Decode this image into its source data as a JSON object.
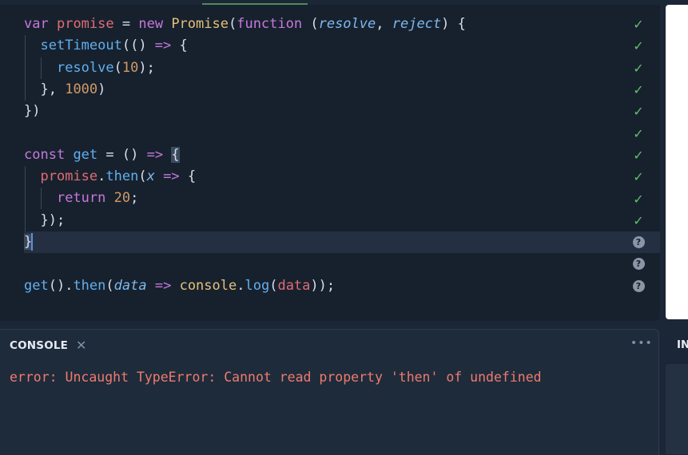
{
  "editor": {
    "lines": [
      [
        [
          "kw",
          "var"
        ],
        [
          "plain",
          " "
        ],
        [
          "var",
          "promise"
        ],
        [
          "plain",
          " = "
        ],
        [
          "kw",
          "new"
        ],
        [
          "plain",
          " "
        ],
        [
          "cls",
          "Promise"
        ],
        [
          "punc",
          "("
        ],
        [
          "kw",
          "function"
        ],
        [
          "plain",
          " ("
        ],
        [
          "par",
          "resolve"
        ],
        [
          "punc",
          ", "
        ],
        [
          "par",
          "reject"
        ],
        [
          "punc",
          ") {"
        ]
      ],
      [
        [
          "plain",
          "  "
        ],
        [
          "fn",
          "setTimeout"
        ],
        [
          "punc",
          "(() "
        ],
        [
          "op",
          "=>"
        ],
        [
          "punc",
          " {"
        ]
      ],
      [
        [
          "plain",
          "    "
        ],
        [
          "fn",
          "resolve"
        ],
        [
          "punc",
          "("
        ],
        [
          "num",
          "10"
        ],
        [
          "punc",
          ");"
        ]
      ],
      [
        [
          "plain",
          "  "
        ],
        [
          "punc",
          "}, "
        ],
        [
          "num",
          "1000"
        ],
        [
          "punc",
          ")"
        ]
      ],
      [
        [
          "punc",
          "})"
        ]
      ],
      [],
      [
        [
          "kw",
          "const"
        ],
        [
          "plain",
          " "
        ],
        [
          "fn",
          "get"
        ],
        [
          "plain",
          " = () "
        ],
        [
          "op",
          "=>"
        ],
        [
          "plain",
          " "
        ],
        [
          "hl",
          "{"
        ]
      ],
      [
        [
          "plain",
          "  "
        ],
        [
          "var",
          "promise"
        ],
        [
          "punc",
          "."
        ],
        [
          "fn",
          "then"
        ],
        [
          "punc",
          "("
        ],
        [
          "par",
          "x"
        ],
        [
          "plain",
          " "
        ],
        [
          "op",
          "=>"
        ],
        [
          "punc",
          " {"
        ]
      ],
      [
        [
          "plain",
          "    "
        ],
        [
          "kw",
          "return"
        ],
        [
          "plain",
          " "
        ],
        [
          "num",
          "20"
        ],
        [
          "punc",
          ";"
        ]
      ],
      [
        [
          "plain",
          "  "
        ],
        [
          "punc",
          "});"
        ]
      ],
      [
        [
          "hl",
          "}"
        ],
        [
          "cursor",
          ""
        ]
      ],
      [],
      [
        [
          "fn",
          "get"
        ],
        [
          "punc",
          "()."
        ],
        [
          "fn",
          "then"
        ],
        [
          "punc",
          "("
        ],
        [
          "par",
          "data"
        ],
        [
          "plain",
          " "
        ],
        [
          "op",
          "=>"
        ],
        [
          "plain",
          " "
        ],
        [
          "cls",
          "console"
        ],
        [
          "punc",
          "."
        ],
        [
          "fn",
          "log"
        ],
        [
          "punc",
          "("
        ],
        [
          "var",
          "data"
        ],
        [
          "punc",
          "));"
        ]
      ]
    ],
    "gutter_marks": [
      "check",
      "check",
      "check",
      "check",
      "check",
      "check",
      "check",
      "check",
      "check",
      "check",
      "question",
      "question",
      "question"
    ],
    "current_line": 10
  },
  "console": {
    "title": "CONSOLE",
    "close_glyph": "✕",
    "more_glyph": "•••",
    "message": "error: Uncaught TypeError: Cannot read property 'then' of undefined"
  },
  "side_panel": {
    "title": "IN"
  },
  "colors": {
    "editor_bg": "#17212d",
    "console_bg": "#1e2b3b",
    "error_text": "#ee7b6e",
    "check": "#5fbf6a"
  },
  "icons": {
    "check": "check-icon",
    "question": "question-circle-icon",
    "close": "close-icon",
    "more": "more-horizontal-icon"
  }
}
